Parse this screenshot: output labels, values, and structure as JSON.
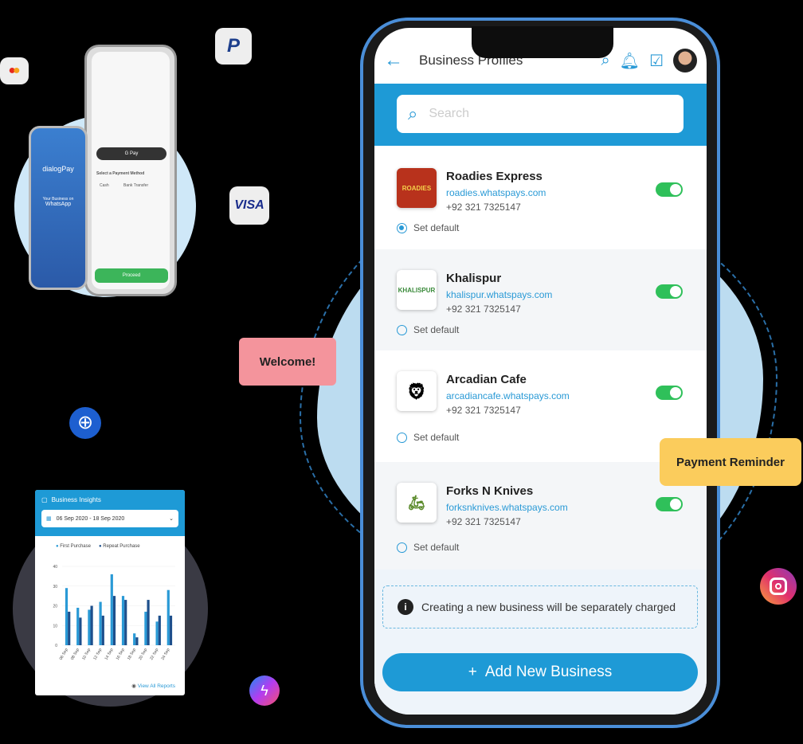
{
  "floating_icons": {
    "mastercard": "mastercard-icon",
    "paypal": "paypal-icon",
    "visa_label": "VISA",
    "globe": "globe-icon",
    "messenger": "messenger-icon",
    "instagram": "instagram-icon"
  },
  "bubbles": {
    "welcome": "Welcome!",
    "payment_reminder": "Payment Reminder"
  },
  "small_phones": {
    "brand": "dialogPay",
    "tagline": "Your Business on",
    "whatsapp": "WhatsApp",
    "gpay": "G Pay",
    "select_method": "Select a Payment Method",
    "cash": "Cash",
    "bank_transfer": "Bank Transfer",
    "proceed": "Proceed"
  },
  "main_phone": {
    "header": {
      "title": "Business Profiles"
    },
    "search": {
      "placeholder": "Search"
    },
    "businesses": [
      {
        "name": "Roadies Express",
        "url": "roadies.whatspays.com",
        "phone": "+92 321 7325147",
        "enabled": true,
        "default": true,
        "set_default_label": "Set default"
      },
      {
        "name": "Khalispur",
        "url": "khalispur.whatspays.com",
        "phone": "+92 321 7325147",
        "enabled": true,
        "default": false,
        "set_default_label": "Set default"
      },
      {
        "name": "Arcadian Cafe",
        "url": "arcadiancafe.whatspays.com",
        "phone": "+92 321 7325147",
        "enabled": true,
        "default": false,
        "set_default_label": "Set default"
      },
      {
        "name": "Forks N Knives",
        "url": "forksnknives.whatspays.com",
        "phone": "+92 321 7325147",
        "enabled": true,
        "default": false,
        "set_default_label": "Set default"
      }
    ],
    "info_text": "Creating a new business will be separately charged",
    "add_button": "Add New Business",
    "colors": {
      "accent": "#1e9ad6",
      "toggle_on": "#2fc05a"
    }
  },
  "insights": {
    "title": "Business Insights",
    "date_range": "06 Sep 2020 - 18 Sep 2020",
    "view_all": "View All Reports",
    "chart_data": {
      "type": "bar",
      "categories": [
        "06 Sep",
        "08 Sep",
        "10 Sep",
        "12 Sep",
        "14 Sep",
        "16 Sep",
        "18 Sep",
        "20 Sep",
        "22 Sep",
        "24 Sep"
      ],
      "series": [
        {
          "name": "First Purchase",
          "color": "#2a9ad6",
          "values": [
            29,
            19,
            18,
            22,
            36,
            25,
            6,
            17,
            12,
            28
          ]
        },
        {
          "name": "Repeat Purchase",
          "color": "#1d4f8c",
          "values": [
            17,
            14,
            20,
            15,
            25,
            23,
            4,
            23,
            15,
            15
          ]
        }
      ],
      "yticks": [
        0,
        10,
        20,
        30,
        40
      ],
      "ylim": [
        0,
        40
      ],
      "legend": "top-left",
      "grid": true
    }
  }
}
